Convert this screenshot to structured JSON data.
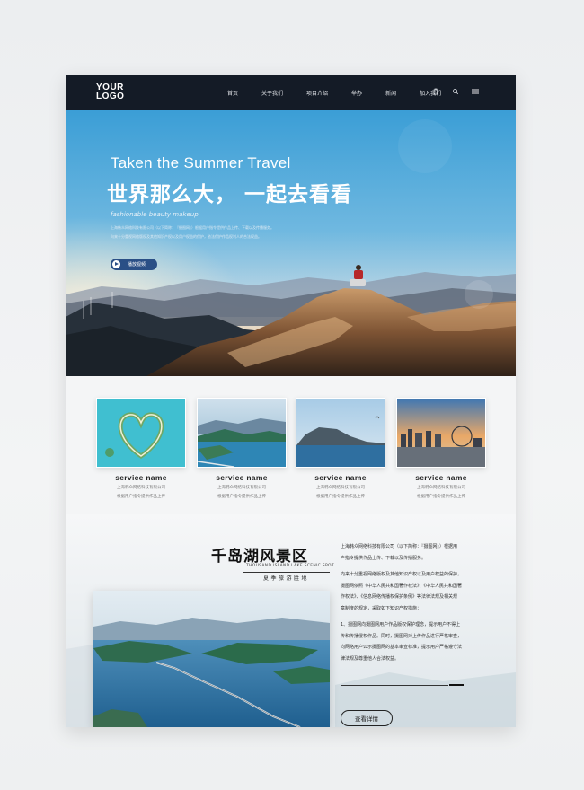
{
  "nav": {
    "logo_line1": "YOUR",
    "logo_line2": "LOGO",
    "items": [
      "首页",
      "关于我们",
      "项目介绍",
      "举办",
      "新闻",
      "加入我们"
    ],
    "icons": [
      "bag-icon",
      "search-icon",
      "menu-icon"
    ]
  },
  "hero": {
    "title_en": "Taken the Summer Travel",
    "title_cn": "世界那么大，  一起去看看",
    "subtitle": "fashionable beauty makeup",
    "desc_line1": "上海韩众网络科技有限公司（以下简称：『摄图网』）根据用户指令提供作品上传、下载以及传播服务。",
    "desc_line2": "向来十分重视网络版权及其他知识产权以及用户权益的保护，依法保护作品权利人的合法权益。",
    "button_label": "播放视频"
  },
  "services": [
    {
      "name": "service name",
      "line1": "上海韩众网络科技有限公司",
      "line2": "根据用户指令提供作品上传"
    },
    {
      "name": "service name",
      "line1": "上海韩众网络科技有限公司",
      "line2": "根据用户指令提供作品上传"
    },
    {
      "name": "service name",
      "line1": "上海韩众网络科技有限公司",
      "line2": "根据用户指令提供作品上传"
    },
    {
      "name": "service name",
      "line1": "上海韩众网络科技有限公司",
      "line2": "根据用户指令提供作品上传"
    }
  ],
  "feature": {
    "title": "千岛湖风景区",
    "title_en": "THOUSAND ISLAND LAKE SCENIC SPOT",
    "subtitle": "夏季旅游胜地",
    "paragraphs": [
      [
        "上海韩众网络科技有限公司（以下简称：『摄图网』）根据用",
        "户指令提供作品上传、下载以及传播服务。"
      ],
      [
        "向来十分重视网络版权及其他知识产权以及用户权益的保护，",
        "摄图网依照《中华人民共和国著作权法》、《中华人民共和国著",
        "作权法》、《信息网络传播权保护条例》等法律法规及相关规",
        "章制度的规定，采取如下知识产权措施："
      ],
      [
        "1、摄图网向摄图网用户作品版权保护理念，提示用户不得上",
        "传和传播侵权作品。同时，摄图网对上传作品进行严格审查，",
        "向网络用户公示摄图网的基本审查标准，提示用户严格遵守法",
        "律法规及尊重他人合法权益。"
      ]
    ],
    "button_label": "查看详情"
  }
}
